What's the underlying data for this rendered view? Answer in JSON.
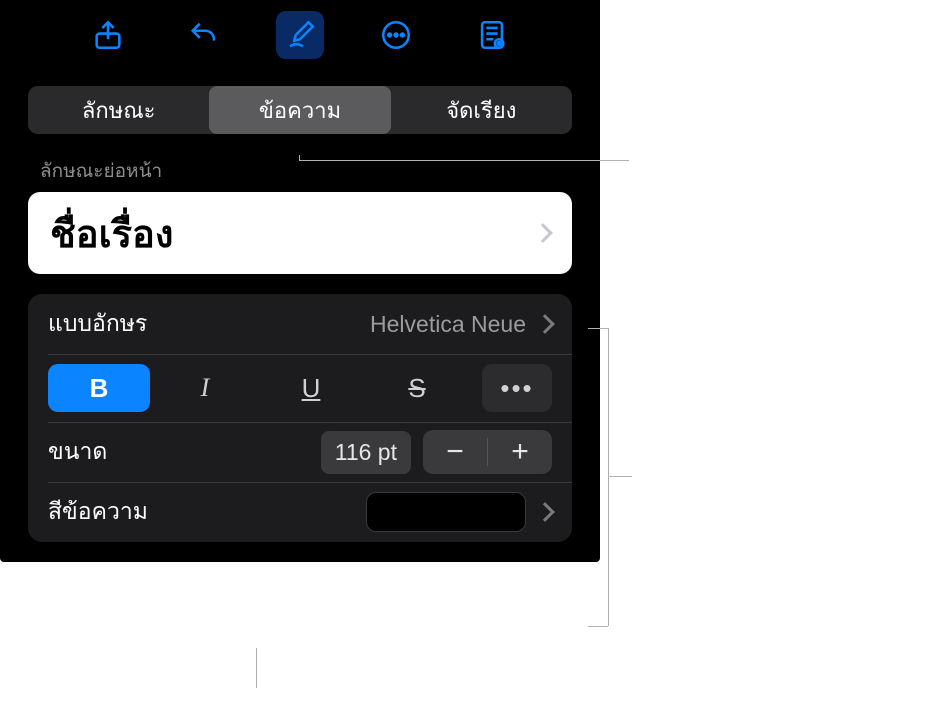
{
  "toolbar": {
    "icons": [
      "share-icon",
      "undo-icon",
      "format-brush-icon",
      "more-icon",
      "view-options-icon"
    ]
  },
  "tabs": {
    "items": [
      "ลักษณะ",
      "ข้อความ",
      "จัดเรียง"
    ],
    "selected_index": 1
  },
  "paragraph_style": {
    "section_label": "ลักษณะย่อหน้า",
    "title": "ชื่อเรื่อง"
  },
  "font": {
    "label": "แบบอักษร",
    "value": "Helvetica Neue"
  },
  "style_buttons": {
    "bold": "B",
    "italic": "I",
    "underline": "U",
    "strike": "S",
    "more": "•••",
    "bold_active": true
  },
  "size": {
    "label": "ขนาด",
    "value": "116 pt",
    "minus": "−",
    "plus": "+"
  },
  "text_color": {
    "label": "สีข้อความ",
    "swatch": "#000000"
  }
}
